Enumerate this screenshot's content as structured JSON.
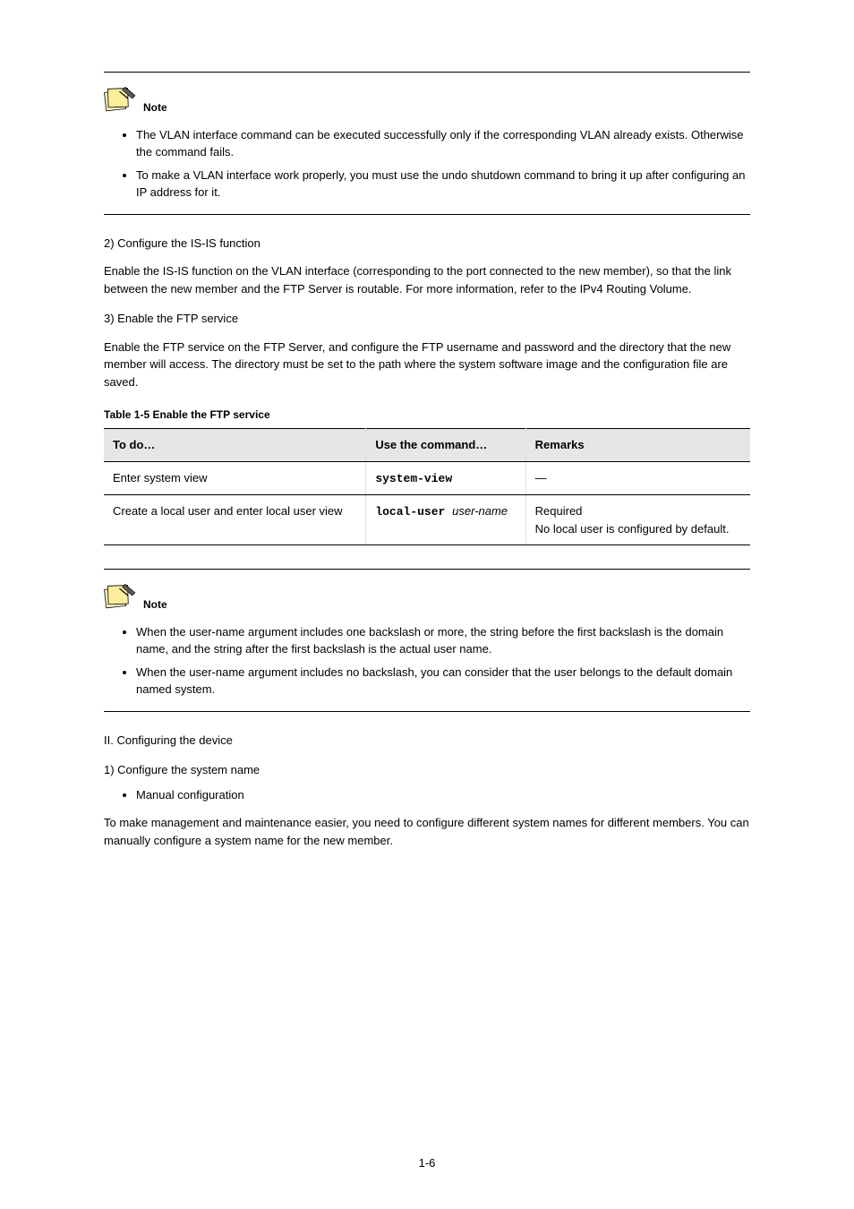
{
  "page_number": "1-6",
  "note1": {
    "label": "Note",
    "items": [
      "The VLAN interface command can be executed successfully only if the corresponding VLAN already exists. Otherwise the command fails.",
      "To make a VLAN interface work properly, you must use the undo shutdown command to bring it up after configuring an IP address for it."
    ]
  },
  "section2": {
    "para2": "2) Configure the IS-IS function",
    "paraAfter2": "Enable the IS-IS function on the VLAN interface (corresponding to the port connected to the new member), so that the link between the new member and the FTP Server is routable. For more information, refer to the IPv4 Routing Volume.",
    "para3": "3) Enable the FTP service",
    "paraAfter3": "Enable the FTP service on the FTP Server, and configure the FTP username and password and the directory that the new member will access. The directory must be set to the path where the system software image and the configuration file are saved."
  },
  "table": {
    "caption": "Table 1-5 Enable the FTP service",
    "headers": [
      "To do…",
      "Use the command…",
      "Remarks"
    ],
    "rows": [
      {
        "c0": "Enter system view",
        "c1": "system-view",
        "c2": "—"
      },
      {
        "c0": "Create a local user and enter local user view",
        "c1_a": "local-user ",
        "c1_b": "user-name",
        "c2": "Required\nNo local user is configured by default."
      }
    ]
  },
  "note2": {
    "label": "Note",
    "items": [
      "When the user-name argument includes one backslash or more, the string before the first backslash is the domain name, and the string after the first backslash is the actual user name.",
      "When the user-name argument includes no backslash, you can consider that the user belongs to the default domain named system."
    ]
  },
  "section3": {
    "romanII": "II. Configuring the device",
    "para1": "1) Configure the system name",
    "outerBullet": "Manual configuration",
    "paraAfter": "To make management and maintenance easier, you need to configure different system names for different members. You can manually configure a system name for the new member."
  }
}
